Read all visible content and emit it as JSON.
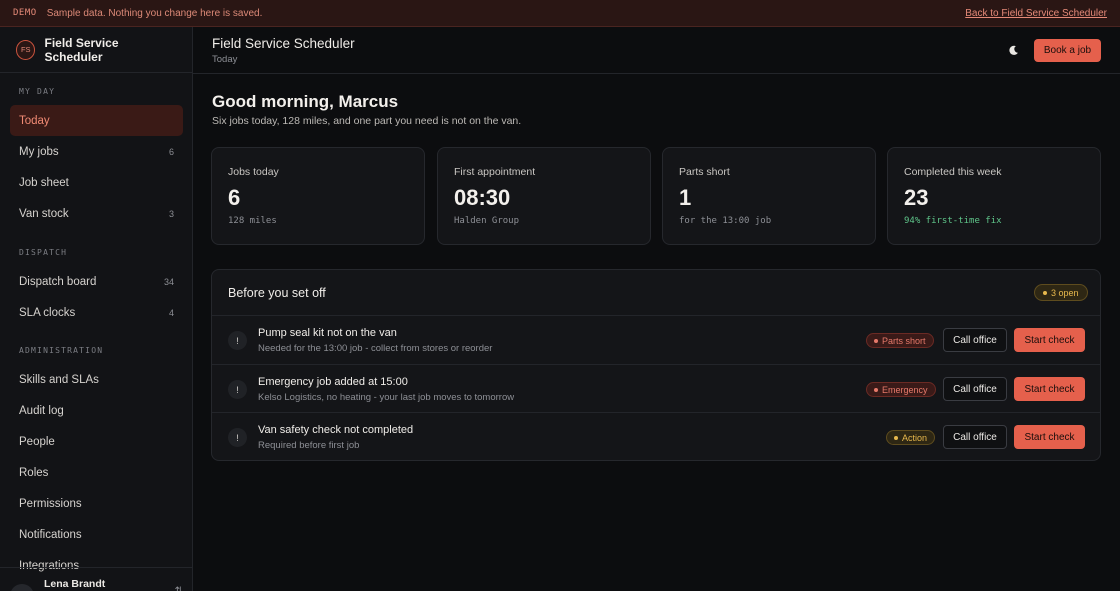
{
  "banner": {
    "tag": "DEMO",
    "message": "Sample data. Nothing you change here is saved.",
    "back_link": "Back to Field Service Scheduler"
  },
  "sidebar": {
    "logo_initials": "FS",
    "app_name": "Field Service Scheduler",
    "sections": [
      {
        "label": "MY DAY",
        "items": [
          {
            "label": "Today",
            "count": "",
            "active": true
          },
          {
            "label": "My jobs",
            "count": "6"
          },
          {
            "label": "Job sheet",
            "count": ""
          },
          {
            "label": "Van stock",
            "count": "3"
          }
        ]
      },
      {
        "label": "DISPATCH",
        "items": [
          {
            "label": "Dispatch board",
            "count": "34"
          },
          {
            "label": "SLA clocks",
            "count": "4"
          }
        ]
      },
      {
        "label": "ADMINISTRATION",
        "items": [
          {
            "label": "Skills and SLAs",
            "count": ""
          },
          {
            "label": "Audit log",
            "count": ""
          },
          {
            "label": "People",
            "count": ""
          },
          {
            "label": "Roles",
            "count": ""
          },
          {
            "label": "Permissions",
            "count": ""
          },
          {
            "label": "Notifications",
            "count": ""
          },
          {
            "label": "Integrations",
            "count": ""
          }
        ]
      }
    ],
    "user": {
      "initials": "LB",
      "name": "Lena Brandt",
      "switch_icon": "⇅"
    }
  },
  "header": {
    "title": "Field Service Scheduler",
    "subtitle": "Today",
    "theme_icon": "moon-icon",
    "book_button": "Book a job"
  },
  "main": {
    "greeting": "Good morning, Marcus",
    "summary": "Six jobs today, 128 miles, and one part you need is not on the van.",
    "stats": [
      {
        "label": "Jobs today",
        "value": "6",
        "note": "128 miles"
      },
      {
        "label": "First appointment",
        "value": "08:30",
        "note": "Halden Group"
      },
      {
        "label": "Parts short",
        "value": "1",
        "note": "for the 13:00 job"
      },
      {
        "label": "Completed this week",
        "value": "23",
        "note": "94% first-time fix"
      }
    ],
    "checklist": {
      "title": "Before you set off",
      "open_badge": "3 open",
      "rows": [
        {
          "icon": "!",
          "title": "Pump seal kit not on the van",
          "subtitle": "Needed for the 13:00 job - collect from stores or reorder",
          "badge": "Parts short",
          "call_label": "Call office",
          "start_label": "Start check"
        },
        {
          "icon": "!",
          "title": "Emergency job added at 15:00",
          "subtitle": "Kelso Logistics, no heating - your last job moves to tomorrow",
          "badge": "Emergency",
          "call_label": "Call office",
          "start_label": "Start check"
        },
        {
          "icon": "!",
          "title": "Van safety check not completed",
          "subtitle": "Required before first job",
          "badge": "Action",
          "call_label": "Call office",
          "start_label": "Start check"
        }
      ]
    }
  },
  "colors": {
    "accent": "#e5604c",
    "active_nav_bg": "#3a1a16",
    "warning": "#e7b84d",
    "danger": "#e6796a",
    "success": "#5fc58a"
  }
}
